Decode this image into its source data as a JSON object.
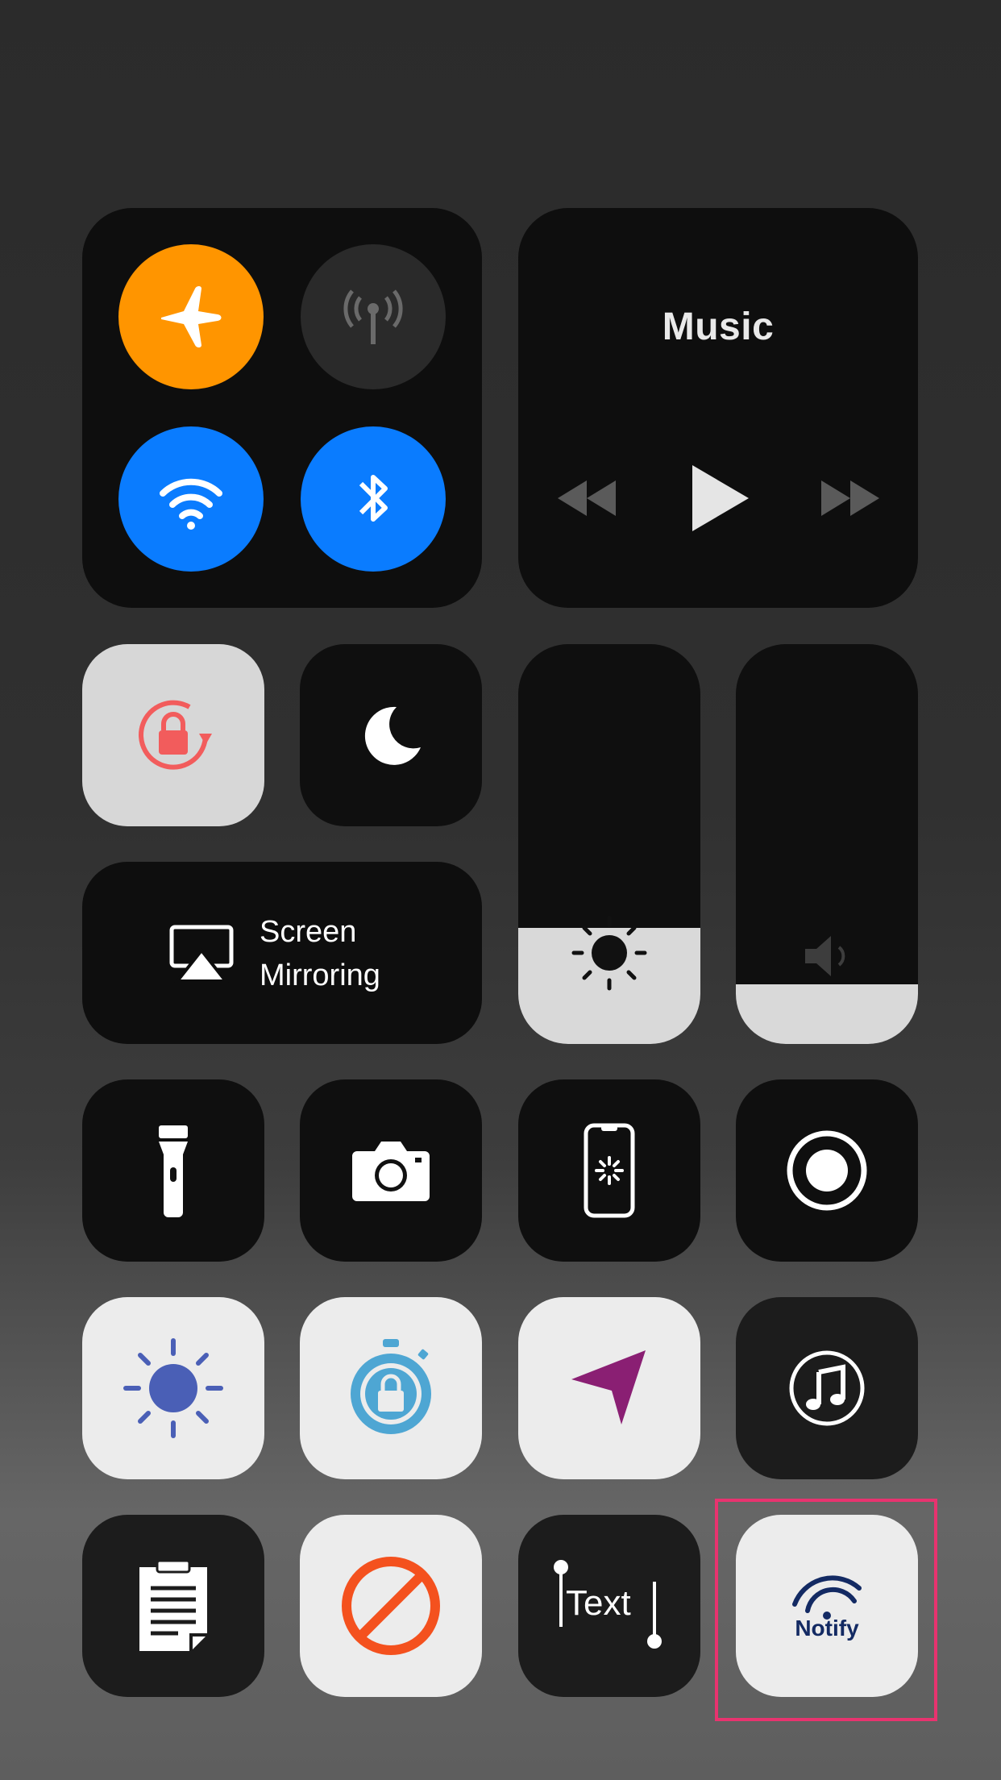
{
  "music": {
    "title": "Music"
  },
  "connectivity": {
    "airplane_mode": "on",
    "cellular": "off",
    "wifi": "on",
    "bluetooth": "on"
  },
  "screen_mirroring": {
    "label_line1": "Screen",
    "label_line2": "Mirroring"
  },
  "sliders": {
    "brightness": 0.29,
    "volume": 0.15
  },
  "tiles": {
    "text_label": "Text",
    "notify_label": "Notify"
  },
  "colors": {
    "airplane": "#ff9500",
    "wifi": "#0a7cff",
    "bluetooth": "#0a7cff",
    "rotation_lock": "#f25c5c",
    "brightness_app": "#4a5fb6",
    "guided_lock": "#4ea6d3",
    "location": "#8a1f73",
    "block": "#f4511e",
    "notify": "#132a63",
    "highlight": "#e8336f"
  }
}
